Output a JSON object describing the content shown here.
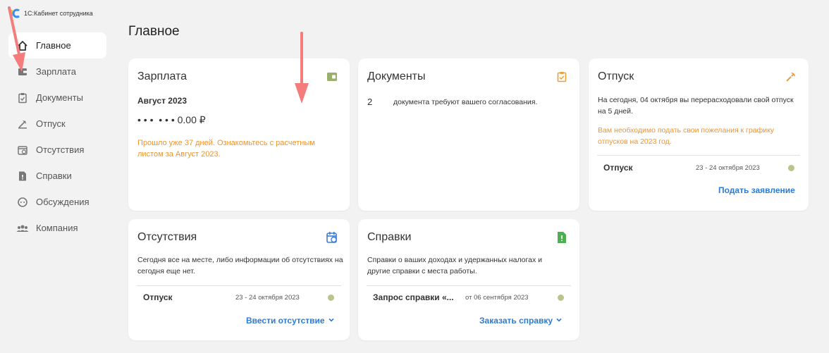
{
  "app": {
    "title": "1С:Кабинет сотрудника",
    "logo_icon": "1c-logo"
  },
  "sidebar": {
    "items": [
      {
        "label": "Главное",
        "icon": "home-icon",
        "active": true
      },
      {
        "label": "Зарплата",
        "icon": "wallet-icon"
      },
      {
        "label": "Документы",
        "icon": "clipboard-icon"
      },
      {
        "label": "Отпуск",
        "icon": "beach-icon"
      },
      {
        "label": "Отсутствия",
        "icon": "calendar-clock-icon"
      },
      {
        "label": "Справки",
        "icon": "document-icon"
      },
      {
        "label": "Обсуждения",
        "icon": "chat-icon"
      },
      {
        "label": "Компания",
        "icon": "people-icon"
      }
    ]
  },
  "page": {
    "title": "Главное"
  },
  "salary": {
    "title": "Зарплата",
    "icon": "wallet-icon",
    "period": "Август 2023",
    "amount_masked": "• • •  • • • 0.00 ₽",
    "notice": "Прошло уже 37 дней. Ознакомьтесь с расчетным листом за Август 2023."
  },
  "documents": {
    "title": "Документы",
    "icon": "clipboard-check-icon",
    "count": "2",
    "text": "документа требуют вашего согласования."
  },
  "vacation": {
    "title": "Отпуск",
    "icon": "beach-icon",
    "text": "На сегодня, 04 октября вы перерасходовали свой отпуск на 5 дней.",
    "notice": "Вам необходимо подать свои пожелания к графику отпусков на 2023 год.",
    "row": {
      "label": "Отпуск",
      "date": "23 - 24 октября 2023"
    },
    "action": "Подать заявление"
  },
  "absences": {
    "title": "Отсутствия",
    "icon": "calendar-clock-icon",
    "text": "Сегодня все на месте, либо информации об отсутствиях на сегодня еще нет.",
    "row": {
      "label": "Отпуск",
      "date": "23 - 24 октября 2023"
    },
    "action": "Ввести отсутствие"
  },
  "certificates": {
    "title": "Справки",
    "icon": "document-alert-icon",
    "text": "Справки о ваших доходах и удержанных налогах и другие справки с места работы.",
    "row": {
      "label": "Запрос справки «...",
      "date": "от 06 сентября 2023"
    },
    "action": "Заказать справку"
  },
  "colors": {
    "accent_link": "#2b7bd6",
    "warning": "#f0932b",
    "status_dot": "#b9c48c",
    "annotation_arrow": "#f47c7c"
  }
}
